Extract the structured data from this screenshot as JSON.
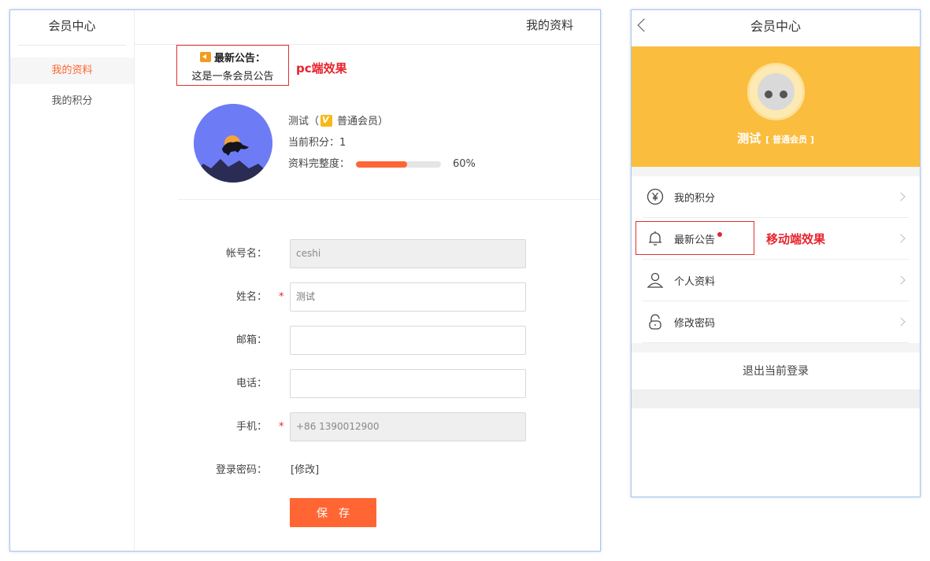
{
  "pc": {
    "sidebar": {
      "title": "会员中心",
      "items": [
        {
          "label": "我的资料",
          "active": true
        },
        {
          "label": "我的积分",
          "active": false
        }
      ]
    },
    "header": {
      "title": "我的资料"
    },
    "notice": {
      "title": "最新公告：",
      "text": "这是一条会员公告"
    },
    "effect_tag": "pc端效果",
    "profile": {
      "name_prefix": "测试（",
      "level": "普通会员",
      "name_suffix": "）",
      "points_label": "当前积分：",
      "points": "1",
      "completeness_label": "资料完整度：",
      "completeness": 0.6,
      "completeness_text": "60%"
    },
    "form": {
      "account_label": "帐号名：",
      "account_value": "ceshi",
      "name_label": "姓名：",
      "name_value": "测试",
      "email_label": "邮箱：",
      "email_value": "",
      "phone_label": "电话：",
      "phone_value": "",
      "mobile_label": "手机：",
      "mobile_value": "+86 1390012900",
      "password_label": "登录密码：",
      "password_link": "[修改]",
      "required_mark": "*",
      "save_label": "保存"
    }
  },
  "mobile": {
    "header_title": "会员中心",
    "name": "测试",
    "level": "[ 普通会员 ]",
    "menu": [
      {
        "label": "我的积分",
        "icon": "yen-icon"
      },
      {
        "label": "最新公告",
        "icon": "bell-icon",
        "dot": true
      },
      {
        "label": "个人资料",
        "icon": "user-icon"
      },
      {
        "label": "修改密码",
        "icon": "lock-icon"
      }
    ],
    "effect_tag": "移动端效果",
    "logout_label": "退出当前登录"
  },
  "colors": {
    "accent": "#ff6633",
    "banner": "#fbbd3e",
    "tag_red": "#e8242e",
    "avatar_bg": "#6d7cf5"
  }
}
